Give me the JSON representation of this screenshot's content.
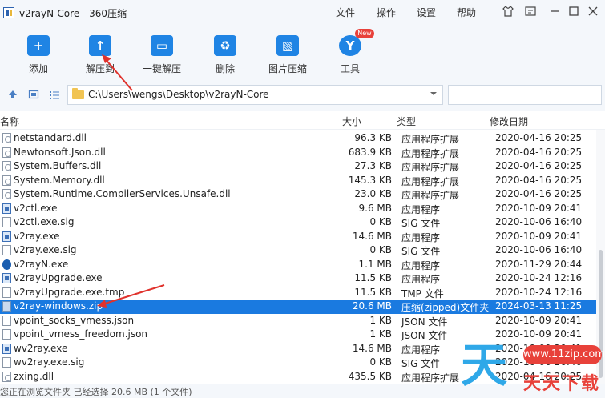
{
  "window": {
    "title": "v2rayN-Core - 360压缩",
    "menus": [
      "文件",
      "操作",
      "设置",
      "帮助"
    ],
    "controls": [
      "skin-icon",
      "feedback-icon",
      "minimize-icon",
      "maximize-icon",
      "close-icon"
    ]
  },
  "toolbar": {
    "items": [
      {
        "label": "添加",
        "icon": "add-icon",
        "glyph": "+"
      },
      {
        "label": "解压到",
        "icon": "extract-to-icon",
        "glyph": "↑"
      },
      {
        "label": "一键解压",
        "icon": "one-click-extract-icon",
        "glyph": "▭"
      },
      {
        "label": "删除",
        "icon": "delete-icon",
        "glyph": "♻"
      },
      {
        "label": "图片压缩",
        "icon": "image-compress-icon",
        "glyph": "▧"
      },
      {
        "label": "工具",
        "icon": "tools-icon",
        "glyph": "Y",
        "badge": "New"
      }
    ]
  },
  "address": {
    "path": "C:\\Users\\wengs\\Desktop\\v2rayN-Core",
    "search_placeholder": ""
  },
  "columns": {
    "name": "名称",
    "size": "大小",
    "type": "类型",
    "mtime": "修改日期"
  },
  "files": [
    {
      "name": "netstandard.dll",
      "size": "96.3 KB",
      "type": "应用程序扩展",
      "mtime": "2020-04-16 20:25",
      "icon": "dll"
    },
    {
      "name": "Newtonsoft.Json.dll",
      "size": "683.9 KB",
      "type": "应用程序扩展",
      "mtime": "2020-04-16 20:25",
      "icon": "dll"
    },
    {
      "name": "System.Buffers.dll",
      "size": "27.3 KB",
      "type": "应用程序扩展",
      "mtime": "2020-04-16 20:25",
      "icon": "dll"
    },
    {
      "name": "System.Memory.dll",
      "size": "145.3 KB",
      "type": "应用程序扩展",
      "mtime": "2020-04-16 20:25",
      "icon": "dll"
    },
    {
      "name": "System.Runtime.CompilerServices.Unsafe.dll",
      "size": "23.0 KB",
      "type": "应用程序扩展",
      "mtime": "2020-04-16 20:25",
      "icon": "dll"
    },
    {
      "name": "v2ctl.exe",
      "size": "9.6 MB",
      "type": "应用程序",
      "mtime": "2020-10-09 20:41",
      "icon": "exe"
    },
    {
      "name": "v2ctl.exe.sig",
      "size": "0 KB",
      "type": "SIG 文件",
      "mtime": "2020-10-06 16:40",
      "icon": "file"
    },
    {
      "name": "v2ray.exe",
      "size": "14.6 MB",
      "type": "应用程序",
      "mtime": "2020-10-09 20:41",
      "icon": "exe"
    },
    {
      "name": "v2ray.exe.sig",
      "size": "0 KB",
      "type": "SIG 文件",
      "mtime": "2020-10-06 16:40",
      "icon": "file"
    },
    {
      "name": "v2rayN.exe",
      "size": "1.1 MB",
      "type": "应用程序",
      "mtime": "2020-11-29 20:44",
      "icon": "v2n"
    },
    {
      "name": "v2rayUpgrade.exe",
      "size": "11.5 KB",
      "type": "应用程序",
      "mtime": "2020-10-24 12:16",
      "icon": "exe"
    },
    {
      "name": "v2rayUpgrade.exe.tmp",
      "size": "11.5 KB",
      "type": "TMP 文件",
      "mtime": "2020-10-24 12:16",
      "icon": "file"
    },
    {
      "name": "v2ray-windows.zip",
      "size": "20.6 MB",
      "type": "压缩(zipped)文件夹",
      "mtime": "2024-03-13 11:25",
      "icon": "zip",
      "selected": true
    },
    {
      "name": "vpoint_socks_vmess.json",
      "size": "1 KB",
      "type": "JSON 文件",
      "mtime": "2020-10-09 20:41",
      "icon": "file"
    },
    {
      "name": "vpoint_vmess_freedom.json",
      "size": "1 KB",
      "type": "JSON 文件",
      "mtime": "2020-10-09 20:41",
      "icon": "file"
    },
    {
      "name": "wv2ray.exe",
      "size": "14.6 MB",
      "type": "应用程序",
      "mtime": "2020-10-09 20:41",
      "icon": "exe"
    },
    {
      "name": "wv2ray.exe.sig",
      "size": "0 KB",
      "type": "SIG 文件",
      "mtime": "2020-10-06 16:40",
      "icon": "file"
    },
    {
      "name": "zxing.dll",
      "size": "435.5 KB",
      "type": "应用程序扩展",
      "mtime": "2020-04-16 20:25",
      "icon": "dll"
    }
  ],
  "status": "您正在浏览文件夹 已经选择 20.6 MB (1 个文件)",
  "watermark": {
    "big": "天",
    "site": "www.11zip.com",
    "sub": "天天下载"
  },
  "colors": {
    "selection": "#1a7ae0",
    "toolbar_icon": "#1f84e4",
    "annotation_arrow": "#e0322c"
  }
}
